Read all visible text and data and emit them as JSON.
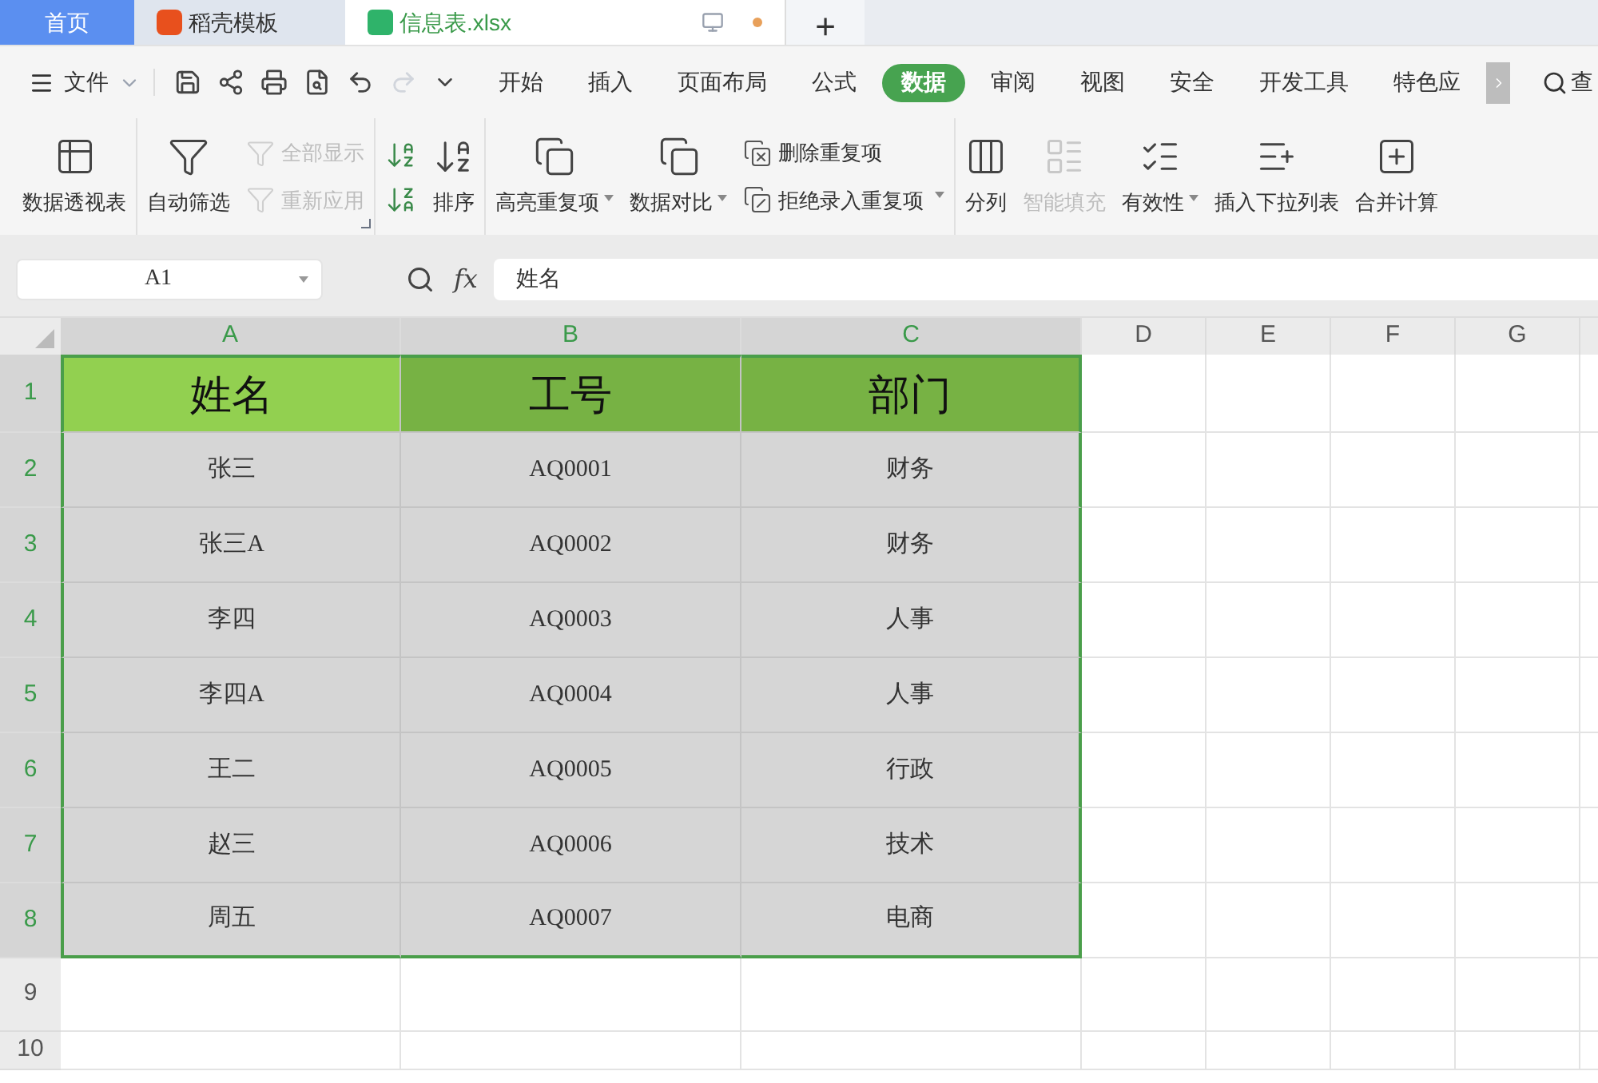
{
  "tabs": [
    {
      "kind": "home",
      "label": "首页",
      "selected": false
    },
    {
      "kind": "template",
      "label": "稻壳模板",
      "selected": false
    },
    {
      "kind": "sheet",
      "label": "信息表.xlsx",
      "selected": true
    }
  ],
  "new_tab": "+",
  "file_menu": "文件",
  "menu_tabs": [
    {
      "label": "开始",
      "selected": false
    },
    {
      "label": "插入",
      "selected": false
    },
    {
      "label": "页面布局",
      "selected": false
    },
    {
      "label": "公式",
      "selected": false
    },
    {
      "label": "数据",
      "selected": true
    },
    {
      "label": "审阅",
      "selected": false
    },
    {
      "label": "视图",
      "selected": false
    },
    {
      "label": "安全",
      "selected": false
    },
    {
      "label": "开发工具",
      "selected": false
    },
    {
      "label": "特色应",
      "selected": false
    }
  ],
  "search_label": "查",
  "ribbon": [
    {
      "items": [
        {
          "kind": "large",
          "label": "数据透视表",
          "disabled": false,
          "dropdown": false
        }
      ]
    },
    {
      "launcher": true,
      "items": [
        {
          "kind": "large",
          "label": "自动筛选",
          "disabled": false,
          "dropdown": false
        },
        {
          "kind": "stack",
          "entries": [
            {
              "label": "全部显示",
              "disabled": true,
              "dropdown": false
            },
            {
              "label": "重新应用",
              "disabled": true,
              "dropdown": false
            }
          ]
        }
      ]
    },
    {
      "items": [
        {
          "kind": "icons"
        },
        {
          "kind": "large",
          "label": "排序",
          "disabled": false,
          "dropdown": false
        }
      ]
    },
    {
      "items": [
        {
          "kind": "large",
          "label": "高亮重复项",
          "disabled": false,
          "dropdown": true
        },
        {
          "kind": "large",
          "label": "数据对比",
          "disabled": false,
          "dropdown": true
        },
        {
          "kind": "stack",
          "entries": [
            {
              "label": "删除重复项",
              "disabled": false,
              "dropdown": false
            },
            {
              "label": "拒绝录入重复项",
              "disabled": false,
              "dropdown": true
            }
          ]
        }
      ]
    },
    {
      "items": [
        {
          "kind": "large",
          "label": "分列",
          "disabled": false,
          "dropdown": false
        },
        {
          "kind": "large",
          "label": "智能填充",
          "disabled": true,
          "dropdown": false
        },
        {
          "kind": "large",
          "label": "有效性",
          "disabled": false,
          "dropdown": true
        },
        {
          "kind": "large",
          "label": "插入下拉列表",
          "disabled": false,
          "dropdown": false
        },
        {
          "kind": "large",
          "label": "合并计算",
          "disabled": false,
          "dropdown": false
        }
      ]
    }
  ],
  "name_box": "A1",
  "fx": "fx",
  "formula": "姓名",
  "columns": [
    {
      "label": "A",
      "selected": true
    },
    {
      "label": "B",
      "selected": true
    },
    {
      "label": "C",
      "selected": true
    },
    {
      "label": "D",
      "selected": false
    },
    {
      "label": "E",
      "selected": false
    },
    {
      "label": "F",
      "selected": false
    },
    {
      "label": "G",
      "selected": false
    }
  ],
  "rows": [
    {
      "label": "1",
      "selected": true,
      "kind": "header",
      "cells": [
        {
          "text": "姓名",
          "active": true
        },
        {
          "text": "工号",
          "active": false
        },
        {
          "text": "部门",
          "active": false
        }
      ]
    },
    {
      "label": "2",
      "selected": true,
      "kind": "data",
      "cells": [
        {
          "text": "张三",
          "active": false
        },
        {
          "text": "AQ0001",
          "active": false
        },
        {
          "text": "财务",
          "active": false
        }
      ]
    },
    {
      "label": "3",
      "selected": true,
      "kind": "data",
      "cells": [
        {
          "text": "张三A",
          "active": false
        },
        {
          "text": "AQ0002",
          "active": false
        },
        {
          "text": "财务",
          "active": false
        }
      ]
    },
    {
      "label": "4",
      "selected": true,
      "kind": "data",
      "cells": [
        {
          "text": "李四",
          "active": false
        },
        {
          "text": "AQ0003",
          "active": false
        },
        {
          "text": "人事",
          "active": false
        }
      ]
    },
    {
      "label": "5",
      "selected": true,
      "kind": "data",
      "cells": [
        {
          "text": "李四A",
          "active": false
        },
        {
          "text": "AQ0004",
          "active": false
        },
        {
          "text": "人事",
          "active": false
        }
      ]
    },
    {
      "label": "6",
      "selected": true,
      "kind": "data",
      "cells": [
        {
          "text": "王二",
          "active": false
        },
        {
          "text": "AQ0005",
          "active": false
        },
        {
          "text": "行政",
          "active": false
        }
      ]
    },
    {
      "label": "7",
      "selected": true,
      "kind": "data",
      "cells": [
        {
          "text": "赵三",
          "active": false
        },
        {
          "text": "AQ0006",
          "active": false
        },
        {
          "text": "技术",
          "active": false
        }
      ]
    },
    {
      "label": "8",
      "selected": true,
      "kind": "data",
      "cells": [
        {
          "text": "周五",
          "active": false
        },
        {
          "text": "AQ0007",
          "active": false
        },
        {
          "text": "电商",
          "active": false
        }
      ]
    },
    {
      "label": "9",
      "selected": false,
      "kind": "empty"
    },
    {
      "label": "10",
      "selected": false,
      "kind": "empty"
    }
  ]
}
